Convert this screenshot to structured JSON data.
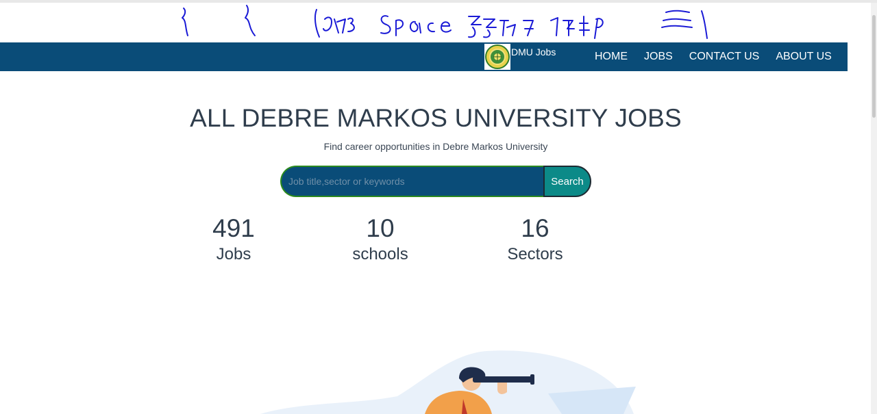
{
  "handwritten_note": "{ { (eɣyɜ Space ʒʒ ɓ7 1ʕ4ρ ≡|",
  "brand": {
    "name": "DMU Jobs",
    "logo_icon": "university-seal-icon"
  },
  "nav": {
    "items": [
      {
        "label": "HOME"
      },
      {
        "label": "JOBS"
      },
      {
        "label": "CONTACT US"
      },
      {
        "label": "ABOUT US"
      }
    ]
  },
  "hero": {
    "title": "ALL DEBRE MARKOS UNIVERSITY JOBS",
    "subtitle": "Find career opportunities in Debre Markos University"
  },
  "search": {
    "placeholder": "Job title,sector or keywords",
    "value": "",
    "button_label": "Search"
  },
  "stats": [
    {
      "value": "491",
      "label": "Jobs"
    },
    {
      "value": "10",
      "label": "schools"
    },
    {
      "value": "16",
      "label": "Sectors"
    }
  ],
  "colors": {
    "navbar": "#0a4c78",
    "search_button": "#0c8a88",
    "text": "#2f3d4c"
  }
}
